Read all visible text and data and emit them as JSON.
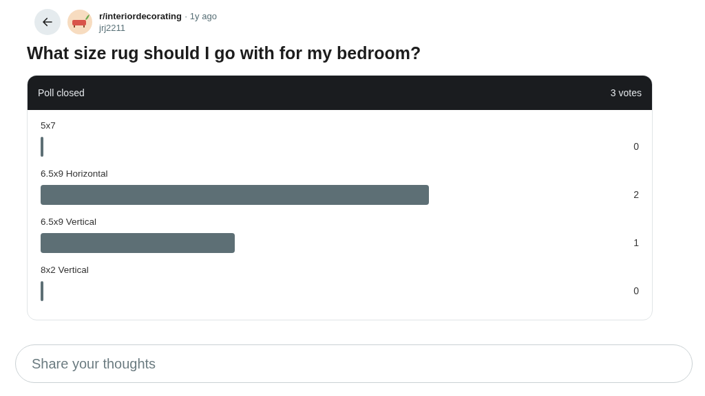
{
  "post": {
    "community": "r/interiordecorating",
    "age": "· 1y ago",
    "author": "jrj2211",
    "title": "What size rug should I go with for my bedroom?"
  },
  "poll": {
    "status": "Poll closed",
    "votes": "3 votes",
    "options": [
      {
        "label": "5x7",
        "count": "0"
      },
      {
        "label": "6.5x9 Horizontal",
        "count": "2"
      },
      {
        "label": "6.5x9 Vertical",
        "count": "1"
      },
      {
        "label": "8x2 Vertical",
        "count": "0"
      }
    ]
  },
  "comment": {
    "placeholder": "Share your thoughts"
  }
}
